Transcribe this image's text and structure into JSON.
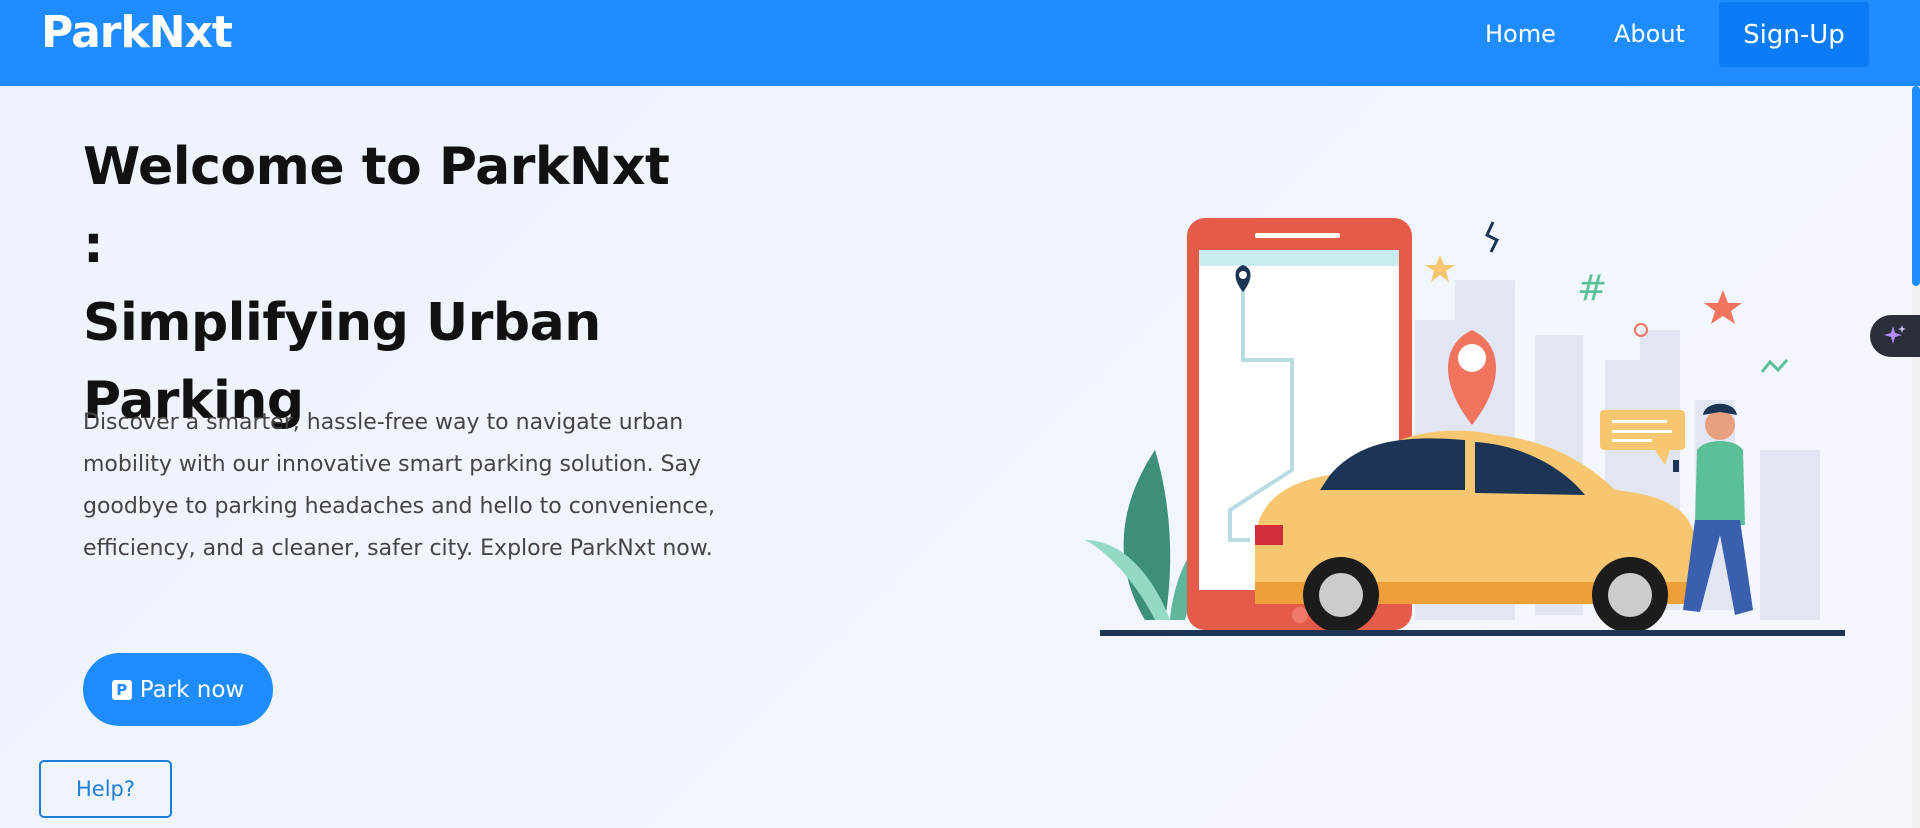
{
  "nav": {
    "brand": "ParkNxt",
    "links": [
      {
        "label": "Home"
      },
      {
        "label": "About"
      }
    ],
    "signup_label": "Sign-Up"
  },
  "hero": {
    "title_lines": [
      "Welcome to ParkNxt :",
      "Simplifying Urban",
      "Parking"
    ],
    "description": "Discover a smarter, hassle-free way to navigate urban mobility with our innovative smart parking solution. Say goodbye to parking headaches and hello to convenience, efficiency, and a cleaner, safer city. Explore ParkNxt now.",
    "cta_label": "Park now",
    "cta_icon": "parking-p-icon"
  },
  "help": {
    "label": "Help?"
  },
  "colors": {
    "primary": "#1e8cfe",
    "text_dark": "#111111",
    "text_body": "#444444"
  },
  "icons": [
    "parking-p-icon",
    "sparkle-icon"
  ]
}
